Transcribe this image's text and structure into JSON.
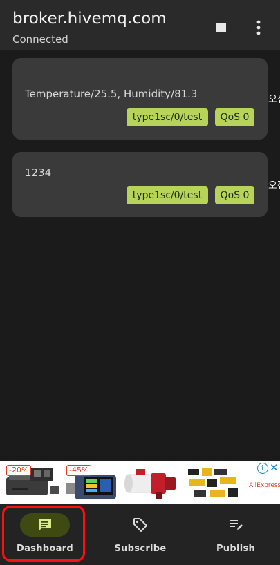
{
  "app_bar": {
    "title": "broker.hivemq.com",
    "subtitle": "Connected"
  },
  "messages": [
    {
      "payload": "Temperature/25.5, Humidity/81.3",
      "topic": "type1sc/0/test",
      "qos": "QoS 0",
      "time_clipped": "오전"
    },
    {
      "payload": "1234",
      "topic": "type1sc/0/test",
      "qos": "QoS 0",
      "time_clipped": "오전"
    }
  ],
  "ad": {
    "badges": [
      "-20%",
      "-45%"
    ],
    "brand": "AliExpress",
    "info_glyph": "i",
    "close_glyph": "✕"
  },
  "bottom_nav": {
    "items": [
      {
        "label": "Dashboard",
        "icon": "dashboard-message-icon",
        "selected": true
      },
      {
        "label": "Subscribe",
        "icon": "tag-icon",
        "selected": false
      },
      {
        "label": "Publish",
        "icon": "publish-edit-icon",
        "selected": false
      }
    ]
  },
  "colors": {
    "background": "#1b1b1b",
    "app_bar": "#2a2a2a",
    "card": "#3a3a3a",
    "chip": "#b7d35a",
    "selected_pill": "#3e4a12",
    "highlight_box": "#ff1010"
  }
}
